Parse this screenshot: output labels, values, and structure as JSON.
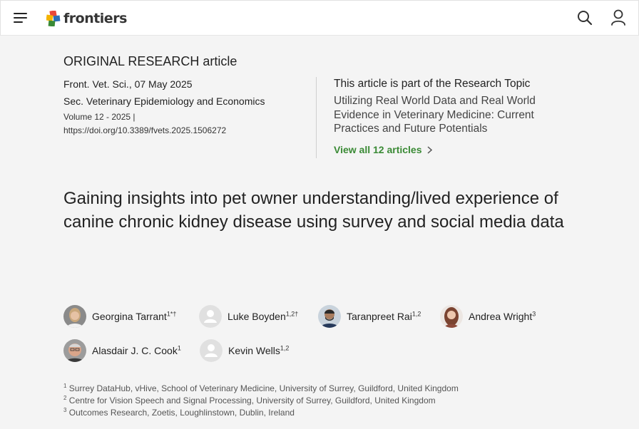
{
  "header": {
    "brand": "frontiers",
    "icons": [
      "menu-icon",
      "search-icon",
      "user-icon"
    ]
  },
  "article": {
    "type": "ORIGINAL RESEARCH article",
    "journal_date": "Front. Vet. Sci., 07 May 2025",
    "section": "Sec. Veterinary Epidemiology and Economics",
    "volume": "Volume 12 - 2025 |",
    "doi": "https://doi.org/10.3389/fvets.2025.1506272",
    "title": "Gaining insights into pet owner understanding/lived experience of canine chronic kidney disease using survey and social media data"
  },
  "research_topic": {
    "heading": "This article is part of the Research Topic",
    "title": "Utilizing Real World Data and Real World Evidence in Veterinary Medicine: Current Practices and Future Potentials",
    "link_label": "View all 12 articles"
  },
  "authors": [
    {
      "name": "Georgina Tarrant",
      "sup": "1*†"
    },
    {
      "name": "Luke Boyden",
      "sup": "1,2†"
    },
    {
      "name": "Taranpreet Rai",
      "sup": "1,2"
    },
    {
      "name": "Andrea Wright",
      "sup": "3"
    },
    {
      "name": "Alasdair J. C. Cook",
      "sup": "1"
    },
    {
      "name": "Kevin Wells",
      "sup": "1,2"
    }
  ],
  "affiliations": [
    {
      "num": "1",
      "text": "Surrey DataHub, vHive, School of Veterinary Medicine, University of Surrey, Guildford, United Kingdom"
    },
    {
      "num": "2",
      "text": "Centre for Vision Speech and Signal Processing, University of Surrey, Guildford, United Kingdom"
    },
    {
      "num": "3",
      "text": "Outcomes Research, Zoetis, Loughlinstown, Dublin, Ireland"
    }
  ],
  "colors": {
    "accent_green": "#3a8a35",
    "background": "#f4f4f4",
    "header_bg": "#ffffff"
  }
}
